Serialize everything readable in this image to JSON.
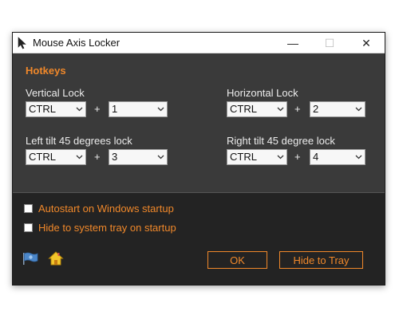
{
  "window": {
    "title": "Mouse Axis Locker",
    "min_symbol": "—",
    "max_symbol": "☐",
    "close_symbol": "✕"
  },
  "hotkeys": {
    "section_title": "Hotkeys",
    "plus": "+",
    "vertical": {
      "label": "Vertical Lock",
      "modifier": "CTRL",
      "key": "1"
    },
    "horizontal": {
      "label": "Horizontal Lock",
      "modifier": "CTRL",
      "key": "2"
    },
    "left_tilt": {
      "label": "Left tilt 45 degrees lock",
      "modifier": "CTRL",
      "key": "3"
    },
    "right_tilt": {
      "label": "Right tilt 45 degree lock",
      "modifier": "CTRL",
      "key": "4"
    }
  },
  "options": {
    "autostart_label": "Autostart on Windows startup",
    "autostart_checked": false,
    "hide_tray_label": "Hide to system tray on startup",
    "hide_tray_checked": false
  },
  "buttons": {
    "ok_label": "OK",
    "hide_label": "Hide to Tray"
  },
  "icons": {
    "app": "cursor-arrow-icon",
    "flag": "flag-icon",
    "home": "home-icon"
  },
  "colors": {
    "accent": "#f0882a",
    "panel": "#3a3a3a",
    "bottom": "#232323"
  }
}
